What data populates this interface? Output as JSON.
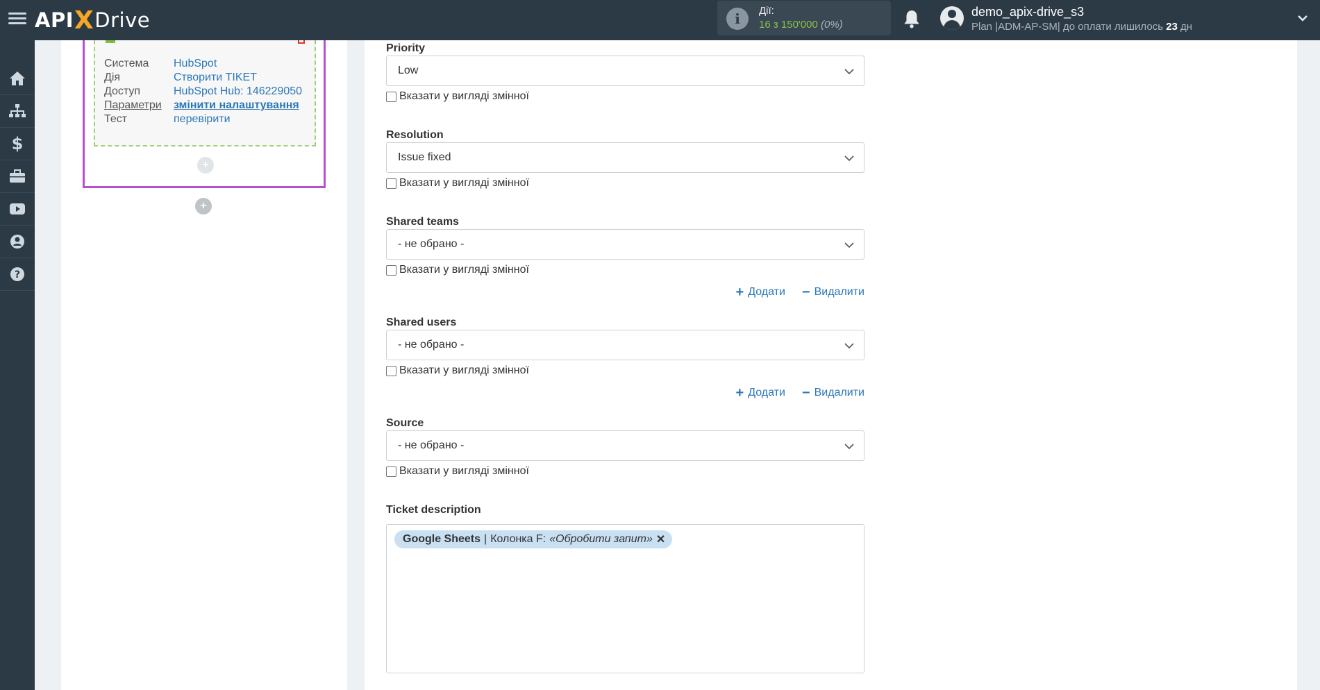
{
  "header": {
    "logo_api": "API",
    "logo_x": "X",
    "logo_drive": "Drive",
    "actions_label": "Дії:",
    "actions_count": "16 з 150'000",
    "actions_pct": "(0%)",
    "user_name": "demo_apix-drive_s3",
    "plan_text": "Plan |ADM-AP-SM| до оплати лишилось ",
    "plan_days": "23",
    "plan_days_unit": " дн"
  },
  "sidebar": {
    "items": [
      "home-icon",
      "sitemap-icon",
      "dollar-icon",
      "briefcase-icon",
      "youtube-icon",
      "user-icon",
      "help-icon"
    ]
  },
  "card": {
    "rows": [
      {
        "key": "Система",
        "value": "HubSpot"
      },
      {
        "key": "Дія",
        "value": "Створити TIKET"
      },
      {
        "key": "Доступ",
        "value": "HubSpot Hub: 146229050"
      },
      {
        "key": "Параметри",
        "value": "змінити налаштування"
      },
      {
        "key": "Тест",
        "value": "перевірити"
      }
    ],
    "plus": "+"
  },
  "form": {
    "var_label": "Вказати у вигляді змінної",
    "add_label": "Додати",
    "remove_label": "Видалити",
    "fields": {
      "priority": {
        "label": "Priority",
        "value": "Low"
      },
      "resolution": {
        "label": "Resolution",
        "value": "Issue fixed"
      },
      "shared_teams": {
        "label": "Shared teams",
        "value": "- не обрано -"
      },
      "shared_users": {
        "label": "Shared users",
        "value": "- не обрано -"
      },
      "source": {
        "label": "Source",
        "value": "- не обрано -"
      }
    },
    "description": {
      "label": "Ticket description",
      "tag_source": "Google Sheets",
      "tag_sep": "|",
      "tag_column": "Колонка F:",
      "tag_value": "«Обробити запит»",
      "tag_remove": "✕"
    }
  }
}
